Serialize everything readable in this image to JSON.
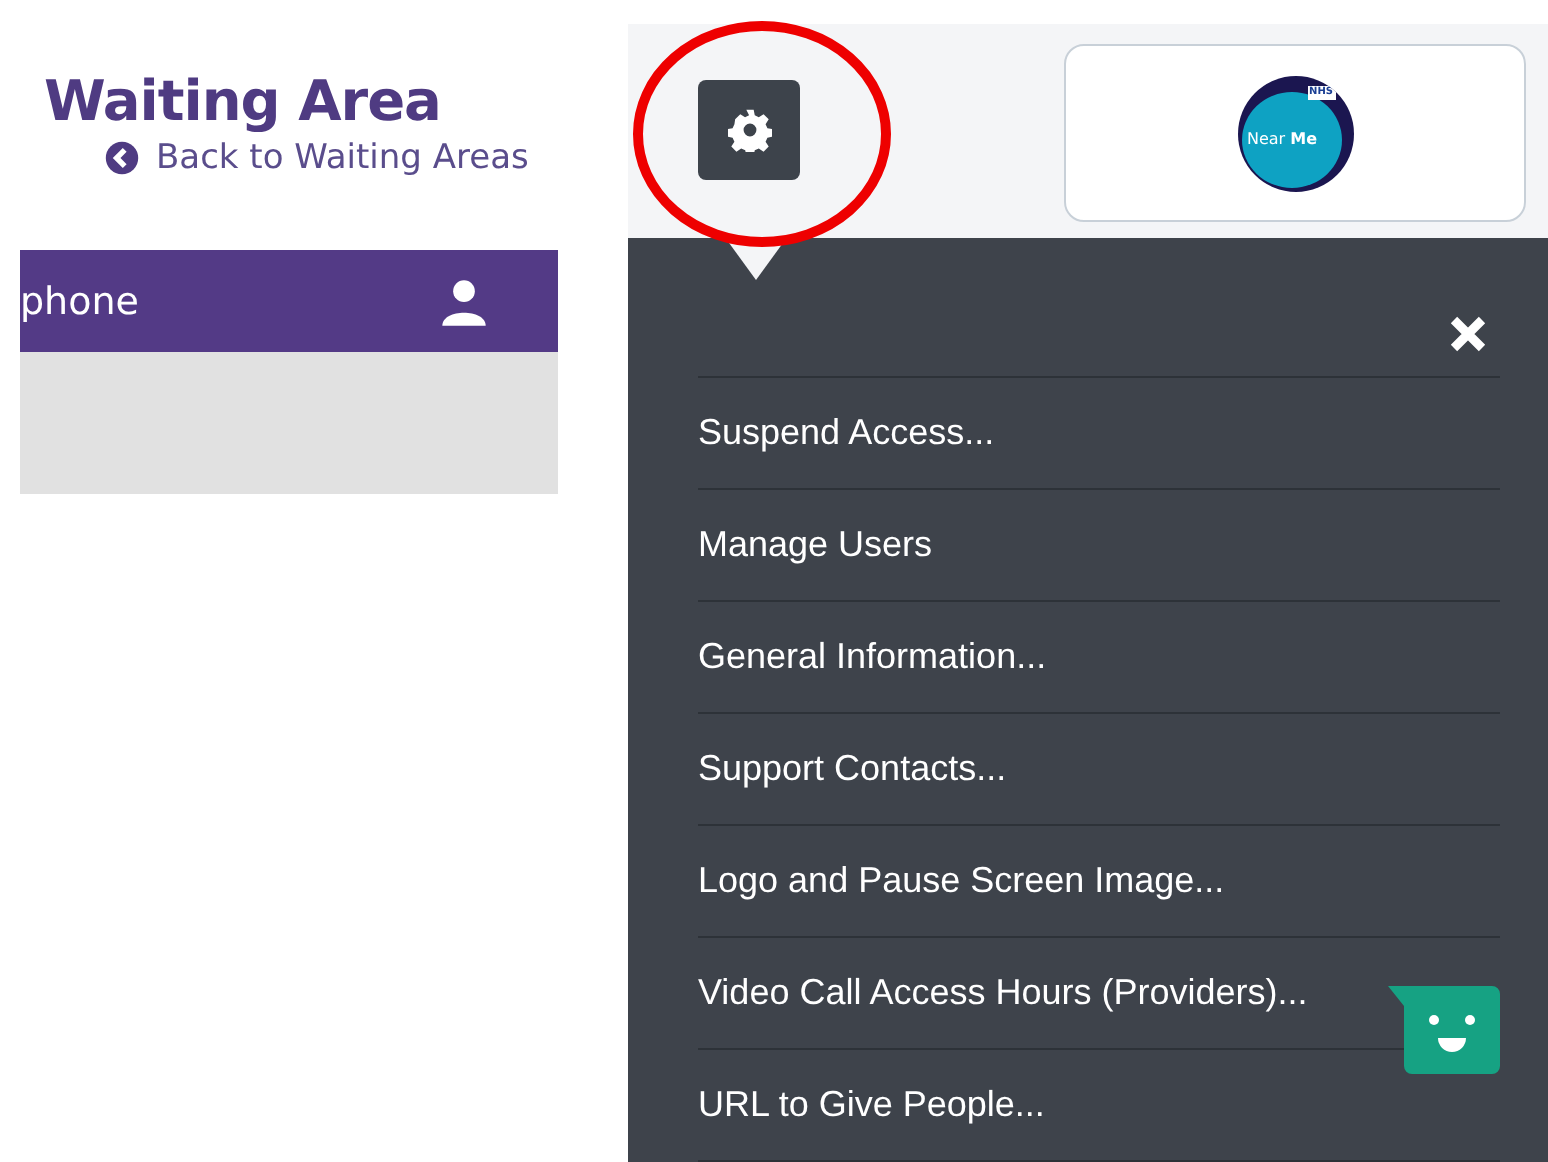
{
  "page": {
    "title": "Waiting Area",
    "back_link": "Back to Waiting Areas"
  },
  "header_bar": {
    "label": "phone"
  },
  "logo": {
    "badge": "NHS",
    "text": "Near **Me**"
  },
  "menu": {
    "items": [
      {
        "label": "Suspend Access..."
      },
      {
        "label": "Manage Users"
      },
      {
        "label": "General Information..."
      },
      {
        "label": "Support Contacts..."
      },
      {
        "label": "Logo and Pause Screen Image..."
      },
      {
        "label": "Video Call Access Hours (Providers)..."
      },
      {
        "label": "URL to Give People..."
      }
    ]
  }
}
